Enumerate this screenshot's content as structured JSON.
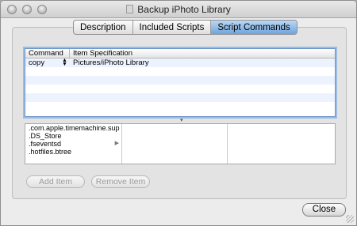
{
  "window": {
    "title": "Backup iPhoto Library"
  },
  "tabs": [
    {
      "label": "Description",
      "active": false
    },
    {
      "label": "Included Scripts",
      "active": false
    },
    {
      "label": "Script Commands",
      "active": true
    }
  ],
  "commands_table": {
    "headers": [
      "Command",
      "Item Specification"
    ],
    "rows": [
      {
        "command": "copy",
        "item": "Pictures/iPhoto Library"
      }
    ]
  },
  "browser": {
    "column1_items": [
      ".com.apple.timemachine.sup",
      ".DS_Store",
      ".fseventsd",
      ".hotfiles.btree"
    ]
  },
  "buttons": {
    "add_item": "Add Item",
    "remove_item": "Remove Item",
    "close": "Close"
  },
  "colors": {
    "active_tab": "#6ea4de",
    "focus_ring": "#9bbce4",
    "row_stripe": "#edf3fe"
  }
}
